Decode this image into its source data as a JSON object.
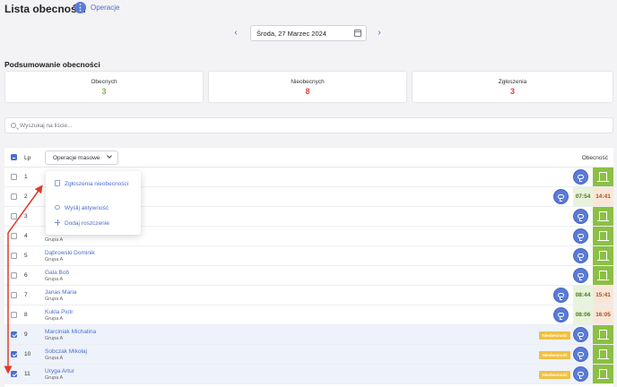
{
  "header": {
    "title": "Lista obecności",
    "ops_label": "Operacje",
    "ops_icon": "dots-vertical-icon"
  },
  "date": {
    "value": "Środa, 27 Marzec 2024",
    "prev": "‹",
    "next": "›"
  },
  "summary": {
    "title": "Podsumowanie obecności",
    "cards": [
      {
        "label": "Obecnych",
        "value": "3",
        "color": "#8bb63a"
      },
      {
        "label": "Nieobecnych",
        "value": "8",
        "color": "#e0453a"
      },
      {
        "label": "Zgłoszenia",
        "value": "3",
        "color": "#e0453a"
      }
    ]
  },
  "search": {
    "placeholder": "Wyszukaj na liście..."
  },
  "table": {
    "col_lp": "Lp",
    "mass_ops": "Operacje masowe",
    "col_attendance": "Obecność",
    "rows": [
      {
        "lp": "1",
        "name": "",
        "group": "",
        "checked": false,
        "chat": true,
        "time_in": "",
        "time_out": "",
        "badge": ""
      },
      {
        "lp": "2",
        "name": "",
        "group": "",
        "checked": false,
        "chat": true,
        "time_in": "07:54",
        "time_out": "14:41",
        "badge": ""
      },
      {
        "lp": "3",
        "name": "",
        "group": "",
        "checked": false,
        "chat": true,
        "time_in": "",
        "time_out": "",
        "badge": ""
      },
      {
        "lp": "4",
        "name": "",
        "group": "Grupa A",
        "checked": false,
        "chat": true,
        "time_in": "",
        "time_out": "",
        "badge": ""
      },
      {
        "lp": "5",
        "name": "Dąbrowski Dominik",
        "group": "Grupa A",
        "checked": false,
        "chat": true,
        "time_in": "",
        "time_out": "",
        "badge": ""
      },
      {
        "lp": "6",
        "name": "Gala Bob",
        "group": "Grupa A",
        "checked": false,
        "chat": true,
        "time_in": "",
        "time_out": "",
        "badge": ""
      },
      {
        "lp": "7",
        "name": "Janas Maria",
        "group": "Grupa A",
        "checked": false,
        "chat": true,
        "time_in": "08:44",
        "time_out": "15:41",
        "badge": ""
      },
      {
        "lp": "8",
        "name": "Kukla Piotr",
        "group": "Grupa A",
        "checked": false,
        "chat": true,
        "time_in": "08:06",
        "time_out": "16:05",
        "badge": ""
      },
      {
        "lp": "9",
        "name": "Marciniak Michalina",
        "group": "Grupa A",
        "checked": true,
        "chat": true,
        "time_in": "",
        "time_out": "",
        "badge": "Nieobecność"
      },
      {
        "lp": "10",
        "name": "Sobczak Mikołaj",
        "group": "Grupa A",
        "checked": true,
        "chat": true,
        "time_in": "",
        "time_out": "",
        "badge": "Nieobecność"
      },
      {
        "lp": "11",
        "name": "Uryga Artur",
        "group": "Grupa A",
        "checked": true,
        "chat": true,
        "time_in": "",
        "time_out": "",
        "badge": "Nieobecność"
      }
    ]
  },
  "dropdown": {
    "items": [
      {
        "label": "Zgłoszenia nieobecności",
        "icon": "document-icon"
      },
      {
        "label": "Wyślij aktywność",
        "icon": "chat-icon"
      },
      {
        "label": "Dodaj roszczenie",
        "icon": "plus-icon"
      }
    ]
  },
  "colors": {
    "accent": "#4a6fd0",
    "present": "#8cbf46",
    "absent_badge": "#f1c040",
    "annotation": "#e03a2a"
  }
}
